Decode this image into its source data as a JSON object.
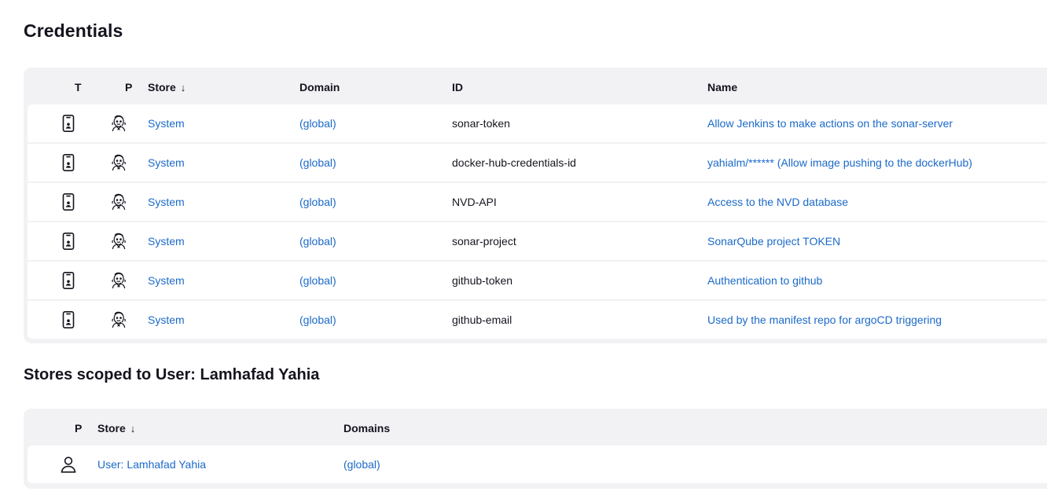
{
  "page": {
    "title": "Credentials"
  },
  "credentials_table": {
    "headers": {
      "type": "T",
      "provider": "P",
      "store": "Store",
      "store_sort": "↓",
      "domain": "Domain",
      "id": "ID",
      "name": "Name"
    },
    "rows": [
      {
        "type_icon": "phone-credential-icon",
        "provider_icon": "jenkins-butler-icon",
        "store": "System",
        "domain": "(global)",
        "id": "sonar-token",
        "name": "Allow Jenkins to make actions on the sonar-server"
      },
      {
        "type_icon": "phone-credential-icon",
        "provider_icon": "jenkins-butler-icon",
        "store": "System",
        "domain": "(global)",
        "id": "docker-hub-credentials-id",
        "name": "yahialm/****** (Allow image pushing to the dockerHub)"
      },
      {
        "type_icon": "phone-credential-icon",
        "provider_icon": "jenkins-butler-icon",
        "store": "System",
        "domain": "(global)",
        "id": "NVD-API",
        "name": "Access to the NVD database"
      },
      {
        "type_icon": "phone-credential-icon",
        "provider_icon": "jenkins-butler-icon",
        "store": "System",
        "domain": "(global)",
        "id": "sonar-project",
        "name": "SonarQube project TOKEN"
      },
      {
        "type_icon": "phone-credential-icon",
        "provider_icon": "jenkins-butler-icon",
        "store": "System",
        "domain": "(global)",
        "id": "github-token",
        "name": "Authentication to github"
      },
      {
        "type_icon": "phone-credential-icon",
        "provider_icon": "jenkins-butler-icon",
        "store": "System",
        "domain": "(global)",
        "id": "github-email",
        "name": "Used by the manifest repo for argoCD triggering"
      }
    ]
  },
  "user_stores": {
    "title": "Stores scoped to User: Lamhafad Yahia",
    "headers": {
      "provider": "P",
      "store": "Store",
      "store_sort": "↓",
      "domains": "Domains"
    },
    "rows": [
      {
        "provider_icon": "user-icon",
        "store": "User: Lamhafad Yahia",
        "domains": "(global)"
      }
    ]
  },
  "colors": {
    "link": "#1b6ac9",
    "table_bg": "#f2f2f5",
    "text": "#14141f"
  }
}
